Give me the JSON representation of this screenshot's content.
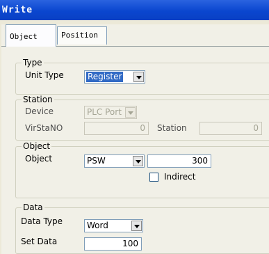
{
  "window": {
    "title": "Write"
  },
  "tabs": [
    {
      "label": "Object",
      "active": true
    },
    {
      "label": "Position",
      "active": false
    }
  ],
  "groups": {
    "type": {
      "legend": "Type",
      "unit_type_label": "Unit Type",
      "unit_type_value": "Register"
    },
    "station": {
      "legend": "Station",
      "device_label": "Device",
      "device_value": "PLC Port",
      "virstano_label": "VirStaNO",
      "virstano_value": "0",
      "station_label": "Station",
      "station_value": "0"
    },
    "object": {
      "legend": "Object",
      "object_label": "Object",
      "object_value": "PSW",
      "address_value": "300",
      "indirect_label": "Indirect",
      "indirect_checked": false
    },
    "data": {
      "legend": "Data",
      "data_type_label": "Data Type",
      "data_type_value": "Word",
      "set_data_label": "Set Data",
      "set_data_value": "100"
    }
  }
}
